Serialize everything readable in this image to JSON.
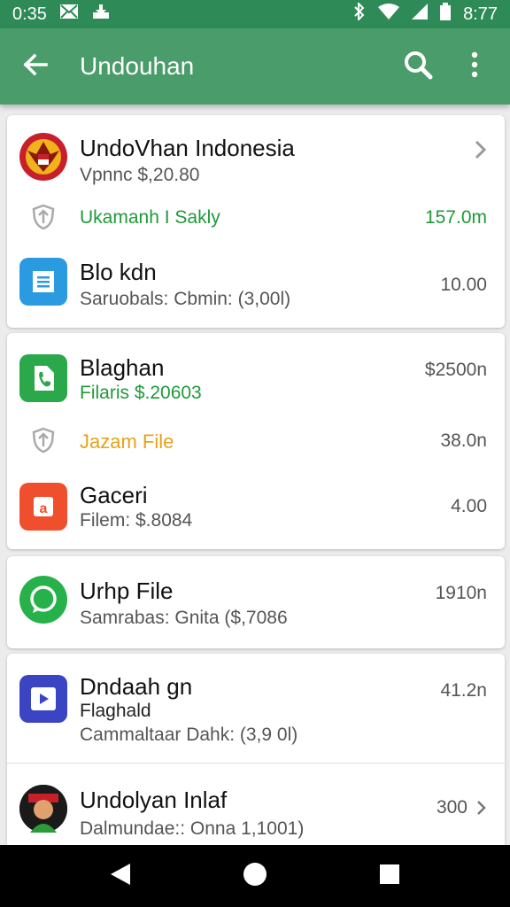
{
  "status_bar": {
    "time_left": "0:35",
    "time_right": "8:77"
  },
  "app_bar": {
    "title": "Undouhan"
  },
  "items": {
    "undovhan": {
      "title": "UndoVhan  Indonesia",
      "subtitle": "Vpnnc $,20.80"
    },
    "ukamanh": {
      "label": "Ukamanh I Sakly",
      "value": "157.0m"
    },
    "blokdn": {
      "title": "Blo kdn",
      "subtitle": "Saruobals: Cbmin: (3,00l)",
      "value": "10.00"
    },
    "blaghan": {
      "title": "Blaghan",
      "subtitle": "Filaris $.20603",
      "value": "$2500n"
    },
    "jazam": {
      "label": "Jazam File",
      "value": "38.0n"
    },
    "gaceri": {
      "title": "Gaceri",
      "subtitle": "Filem: $.8084",
      "value": "4.00"
    },
    "urhp": {
      "title": "Urhp File",
      "subtitle": "Samrabas: Gnita ($,7086",
      "value": "1910n"
    },
    "dndaah": {
      "title": "Dndaah gn",
      "subtitle": "Flaghald",
      "subtitle2": "Cammaltaar Dahk: (3,9 0l)",
      "value": "41.2n"
    },
    "undolyan": {
      "title": "Undolyan Inlaf",
      "subtitle": "Dalmundae:: Onna 1,1001)",
      "value": "300"
    }
  },
  "colors": {
    "status_bar": "#2e8b57",
    "app_bar": "#4a9d6a",
    "green_text": "#1e9a3a",
    "orange_text": "#e6a21b",
    "blue_icon": "#2a9be0",
    "green_icon": "#2aa84a",
    "red_icon": "#ef4f2c",
    "whatsapp_icon": "#27b14a",
    "video_icon": "#3b45c4"
  },
  "icons": {
    "back": "arrow-left-icon",
    "search": "search-icon",
    "more": "more-vert-icon",
    "nav_back": "triangle-back-icon",
    "nav_home": "circle-home-icon",
    "nav_recents": "square-recents-icon"
  }
}
